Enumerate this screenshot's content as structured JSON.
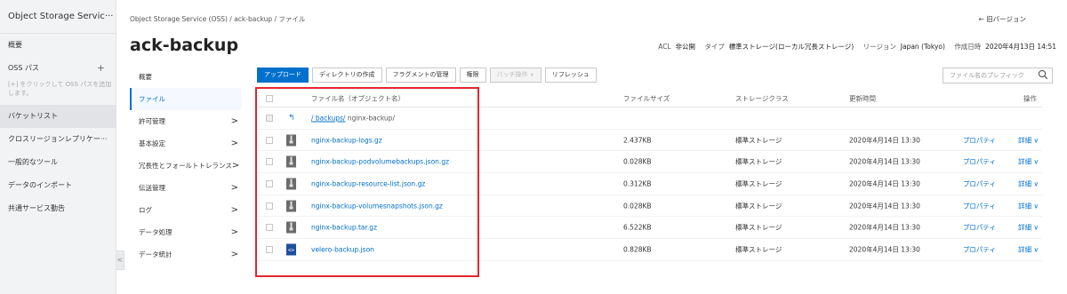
{
  "leftnav": {
    "title": "Object Storage Servic···",
    "overview": "概要",
    "oss_path": "OSS パス",
    "plus": "+",
    "hint": "[+] をクリックして OSS パスを追加します。",
    "items": [
      {
        "label": "バケットリスト"
      },
      {
        "label": "クロスリージョンレプリケー···"
      },
      {
        "label": "一般的なツール"
      },
      {
        "label": "データのインポート"
      },
      {
        "label": "共通サービス動告"
      }
    ],
    "collapse": "<"
  },
  "header": {
    "breadcrumb": "Object Storage Service (OSS)  /  ack-backup  /  ファイル",
    "old_version": "← 旧バージョン",
    "title": "ack-backup",
    "acl_label": "ACL",
    "acl_value": "非公開",
    "type_label": "タイプ",
    "type_value": "標準ストレージ(ローカル冗長ストレージ)",
    "region_label": "リージョン",
    "region_value": "Japan (Tokyo)",
    "created_label": "作成日時",
    "created_value": "2020年4月13日 14:51"
  },
  "subnav": [
    {
      "label": "概要",
      "chevron": ""
    },
    {
      "label": "ファイル",
      "chevron": ""
    },
    {
      "label": "許可管理",
      "chevron": ">"
    },
    {
      "label": "基本設定",
      "chevron": ">"
    },
    {
      "label": "冗長性とフォールトトレランス",
      "chevron": ">"
    },
    {
      "label": "伝送管理",
      "chevron": ">"
    },
    {
      "label": "ログ",
      "chevron": ">"
    },
    {
      "label": "データ処理",
      "chevron": ">"
    },
    {
      "label": "データ統計",
      "chevron": ">"
    }
  ],
  "toolbar": {
    "upload": "アップロード",
    "create_dir": "ディレクトリの作成",
    "fragments": "フラグメントの管理",
    "permissions": "権限",
    "batch": "バッチ操作 ∨",
    "refresh": "リフレッシュ",
    "search_placeholder": "ファイル名のプレフィック"
  },
  "table": {
    "headers": {
      "name": "ファイル名（オブジェクト名）",
      "size": "ファイルサイズ",
      "storage": "ストレージクラス",
      "updated": "更新時間",
      "actions": "操作"
    },
    "parent": {
      "arrow": "↰",
      "link": "/ backups/",
      "path": "nginx-backup/"
    },
    "rows": [
      {
        "name": "nginx-backup-logs.gz",
        "size": "2.437KB",
        "storage": "標準ストレージ",
        "updated": "2020年4月14日 13:30",
        "prop": "プロパティ",
        "detail": "詳細 ∨",
        "icon": "file-icon"
      },
      {
        "name": "nginx-backup-podvolumebackups.json.gz",
        "size": "0.028KB",
        "storage": "標準ストレージ",
        "updated": "2020年4月14日 13:30",
        "prop": "プロパティ",
        "detail": "詳細 ∨",
        "icon": "file-icon"
      },
      {
        "name": "nginx-backup-resource-list.json.gz",
        "size": "0.312KB",
        "storage": "標準ストレージ",
        "updated": "2020年4月14日 13:30",
        "prop": "プロパティ",
        "detail": "詳細 ∨",
        "icon": "file-icon"
      },
      {
        "name": "nginx-backup-volumesnapshots.json.gz",
        "size": "0.028KB",
        "storage": "標準ストレージ",
        "updated": "2020年4月14日 13:30",
        "prop": "プロパティ",
        "detail": "詳細 ∨",
        "icon": "file-icon"
      },
      {
        "name": "nginx-backup.tar.gz",
        "size": "6.522KB",
        "storage": "標準ストレージ",
        "updated": "2020年4月14日 13:30",
        "prop": "プロパティ",
        "detail": "詳細 ∨",
        "icon": "file-icon"
      },
      {
        "name": "velero-backup.json",
        "size": "0.828KB",
        "storage": "標準ストレージ",
        "updated": "2020年4月14日 13:30",
        "prop": "プロパティ",
        "detail": "詳細 ∨",
        "icon": "code-file-icon"
      }
    ]
  },
  "colors": {
    "accent": "#0070cc",
    "highlight": "#e3262f"
  }
}
